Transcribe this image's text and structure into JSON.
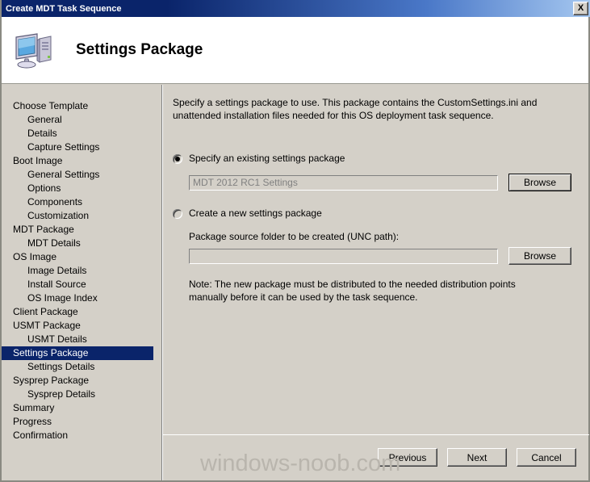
{
  "window": {
    "title": "Create MDT Task Sequence",
    "close_label": "X"
  },
  "header": {
    "title": "Settings Package",
    "icon": "computer-icon"
  },
  "sidebar": {
    "items": [
      {
        "label": "Choose Template",
        "level": 0,
        "selected": false
      },
      {
        "label": "General",
        "level": 1,
        "selected": false
      },
      {
        "label": "Details",
        "level": 1,
        "selected": false
      },
      {
        "label": "Capture Settings",
        "level": 1,
        "selected": false
      },
      {
        "label": "Boot Image",
        "level": 0,
        "selected": false
      },
      {
        "label": "General Settings",
        "level": 1,
        "selected": false
      },
      {
        "label": "Options",
        "level": 1,
        "selected": false
      },
      {
        "label": "Components",
        "level": 1,
        "selected": false
      },
      {
        "label": "Customization",
        "level": 1,
        "selected": false
      },
      {
        "label": "MDT Package",
        "level": 0,
        "selected": false
      },
      {
        "label": "MDT Details",
        "level": 1,
        "selected": false
      },
      {
        "label": "OS Image",
        "level": 0,
        "selected": false
      },
      {
        "label": "Image Details",
        "level": 1,
        "selected": false
      },
      {
        "label": "Install Source",
        "level": 1,
        "selected": false
      },
      {
        "label": "OS Image Index",
        "level": 1,
        "selected": false
      },
      {
        "label": "Client Package",
        "level": 0,
        "selected": false
      },
      {
        "label": "USMT Package",
        "level": 0,
        "selected": false
      },
      {
        "label": "USMT Details",
        "level": 1,
        "selected": false
      },
      {
        "label": "Settings Package",
        "level": 0,
        "selected": true
      },
      {
        "label": "Settings Details",
        "level": 1,
        "selected": false
      },
      {
        "label": "Sysprep Package",
        "level": 0,
        "selected": false
      },
      {
        "label": "Sysprep Details",
        "level": 1,
        "selected": false
      },
      {
        "label": "Summary",
        "level": 0,
        "selected": false
      },
      {
        "label": "Progress",
        "level": 0,
        "selected": false
      },
      {
        "label": "Confirmation",
        "level": 0,
        "selected": false
      }
    ]
  },
  "main": {
    "intro": "Specify a settings package to use.  This package contains the CustomSettings.ini and unattended installation files needed for this OS deployment task sequence.",
    "option_existing": {
      "label": "Specify an existing settings package",
      "selected": true,
      "value": "MDT 2012 RC1 Settings",
      "browse_label": "Browse"
    },
    "option_new": {
      "label": "Create a new settings package",
      "selected": false,
      "field_label": "Package source folder to be created (UNC path):",
      "value": "",
      "browse_label": "Browse",
      "note": "Note: The new package must be distributed to the needed distribution points manually before it can be used by the task sequence."
    }
  },
  "footer": {
    "previous_label": "Previous",
    "next_label": "Next",
    "cancel_label": "Cancel"
  },
  "watermark": {
    "text": "windows-noob.com"
  },
  "colors": {
    "titlebar_start": "#0a246a",
    "titlebar_end": "#a6c8f0",
    "face": "#d4d0c8",
    "selection": "#0a246a",
    "watermark": "#b9b5ad"
  }
}
